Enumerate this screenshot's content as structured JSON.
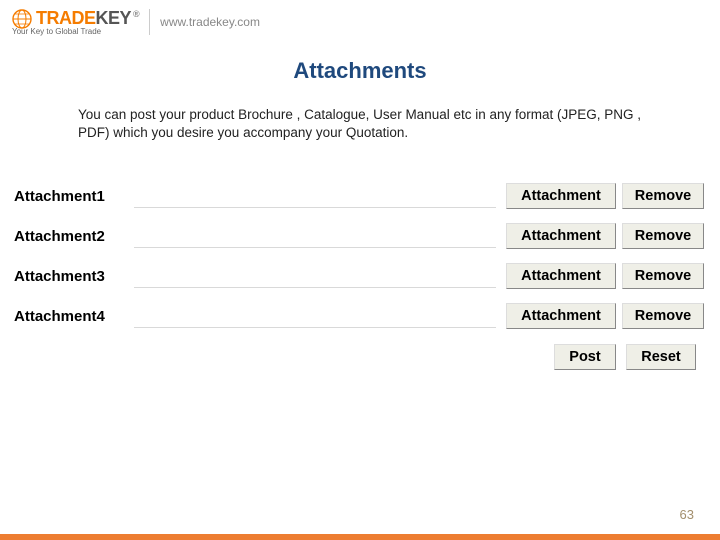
{
  "header": {
    "brand_first": "TRADE",
    "brand_second": "KEY",
    "tagline": "Your Key to Global Trade",
    "url": "www.tradekey.com"
  },
  "title": "Attachments",
  "description": "You can post your product Brochure , Catalogue, User Manual etc in any format (JPEG, PNG , PDF) which you desire you accompany your Quotation.",
  "rows": [
    {
      "label": "Attachment1",
      "attach": "Attachment",
      "remove": "Remove"
    },
    {
      "label": "Attachment2",
      "attach": "Attachment",
      "remove": "Remove"
    },
    {
      "label": "Attachment3",
      "attach": "Attachment",
      "remove": "Remove"
    },
    {
      "label": "Attachment4",
      "attach": "Attachment",
      "remove": "Remove"
    }
  ],
  "actions": {
    "post": "Post",
    "reset": "Reset"
  },
  "page_number": "63"
}
